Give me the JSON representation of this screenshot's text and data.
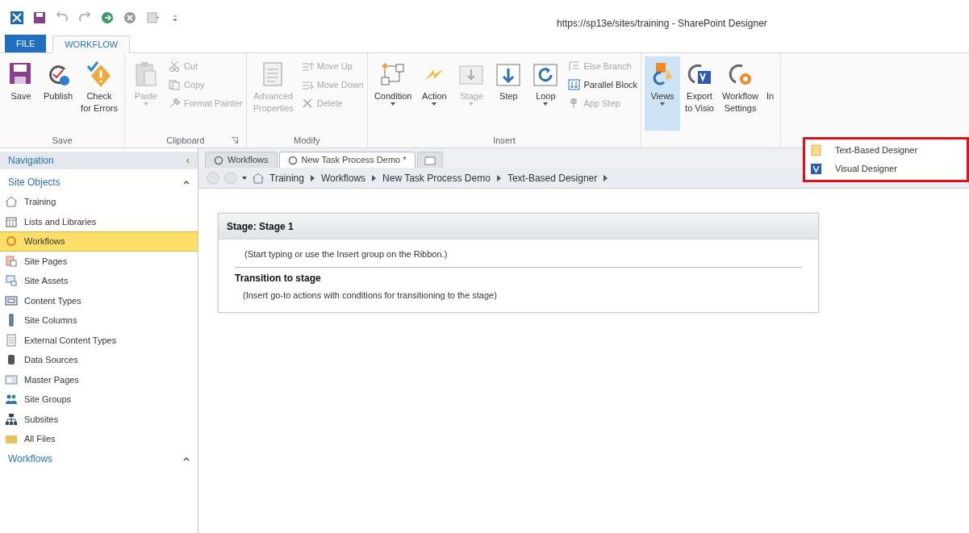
{
  "window": {
    "title": "https://sp13e/sites/training - SharePoint Designer"
  },
  "ribbon_tabs": [
    {
      "label": "FILE",
      "kind": "file",
      "selected": false
    },
    {
      "label": "WORKFLOW",
      "kind": "tab",
      "selected": true
    }
  ],
  "ribbon_groups": [
    {
      "label": "Save",
      "launcher": false,
      "buttons": [
        {
          "label": "Save",
          "kind": "large",
          "disabled": false,
          "dropdown": false,
          "selected": false
        },
        {
          "label": "Publish",
          "kind": "large",
          "disabled": false,
          "dropdown": false,
          "selected": false
        },
        {
          "label": "Check\nfor Errors",
          "kind": "large",
          "disabled": false,
          "dropdown": false,
          "selected": false
        }
      ]
    },
    {
      "label": "Clipboard",
      "launcher": true,
      "buttons": [
        {
          "label": "Paste",
          "kind": "large",
          "disabled": true,
          "dropdown": true,
          "selected": false
        },
        {
          "label": "Cut",
          "kind": "small",
          "disabled": true,
          "dropdown": false,
          "selected": false
        },
        {
          "label": "Copy",
          "kind": "small",
          "disabled": true,
          "dropdown": false,
          "selected": false
        },
        {
          "label": "Format Painter",
          "kind": "small",
          "disabled": true,
          "dropdown": false,
          "selected": false
        }
      ]
    },
    {
      "label": "Modify",
      "launcher": false,
      "buttons": [
        {
          "label": "Advanced\nProperties",
          "kind": "large",
          "disabled": true,
          "dropdown": false,
          "selected": false
        },
        {
          "label": "Move Up",
          "kind": "small",
          "disabled": true,
          "dropdown": false,
          "selected": false
        },
        {
          "label": "Move Down",
          "kind": "small",
          "disabled": true,
          "dropdown": false,
          "selected": false
        },
        {
          "label": "Delete",
          "kind": "small",
          "disabled": true,
          "dropdown": false,
          "selected": false
        }
      ]
    },
    {
      "label": "Insert",
      "launcher": false,
      "buttons": [
        {
          "label": "Condition",
          "kind": "large",
          "disabled": false,
          "dropdown": true,
          "selected": false
        },
        {
          "label": "Action",
          "kind": "large",
          "disabled": false,
          "dropdown": true,
          "selected": false
        },
        {
          "label": "Stage",
          "kind": "large",
          "disabled": true,
          "dropdown": true,
          "selected": false
        },
        {
          "label": "Step",
          "kind": "large",
          "disabled": false,
          "dropdown": false,
          "selected": false
        },
        {
          "label": "Loop",
          "kind": "large",
          "disabled": false,
          "dropdown": true,
          "selected": false
        },
        {
          "label": "Else Branch",
          "kind": "small",
          "disabled": true,
          "dropdown": false,
          "selected": false
        },
        {
          "label": "Parallel Block",
          "kind": "small",
          "disabled": false,
          "dropdown": false,
          "selected": false
        },
        {
          "label": "App Step",
          "kind": "small",
          "disabled": true,
          "dropdown": false,
          "selected": false
        }
      ]
    },
    {
      "launcher": false,
      "buttons": [
        {
          "label": "Views",
          "kind": "large",
          "disabled": false,
          "dropdown": true,
          "selected": true
        },
        {
          "label": "Export\nto Visio",
          "kind": "large",
          "disabled": false,
          "dropdown": false,
          "selected": false
        },
        {
          "label": "Workflow\nSettings",
          "kind": "large",
          "disabled": false,
          "dropdown": false,
          "selected": false
        },
        {
          "label": "In",
          "kind": "large",
          "disabled": false,
          "dropdown": false,
          "selected": false
        }
      ]
    }
  ],
  "views_menu": {
    "items": [
      {
        "label": "Text-Based Designer"
      },
      {
        "label": "Visual Designer"
      }
    ]
  },
  "navigation": {
    "title": "Navigation",
    "collapse_glyph": "‹",
    "sections": [
      {
        "title": "Site Objects",
        "expanded": true,
        "items": [
          {
            "label": "Training",
            "selected": false
          },
          {
            "label": "Lists and Libraries",
            "selected": false
          },
          {
            "label": "Workflows",
            "selected": true
          },
          {
            "label": "Site Pages",
            "selected": false
          },
          {
            "label": "Site Assets",
            "selected": false
          },
          {
            "label": "Content Types",
            "selected": false
          },
          {
            "label": "Site Columns",
            "selected": false
          },
          {
            "label": "External Content Types",
            "selected": false
          },
          {
            "label": "Data Sources",
            "selected": false
          },
          {
            "label": "Master Pages",
            "selected": false
          },
          {
            "label": "Site Groups",
            "selected": false
          },
          {
            "label": "Subsites",
            "selected": false
          },
          {
            "label": "All Files",
            "selected": false
          }
        ]
      },
      {
        "title": "Workflows",
        "expanded": true
      }
    ]
  },
  "document_tabs": [
    {
      "label": "Workflows",
      "selected": false
    },
    {
      "label": "New Task Process Demo *",
      "selected": true
    }
  ],
  "breadcrumb": [
    "Training",
    "Workflows",
    "New Task Process Demo",
    "Text-Based Designer"
  ],
  "stage": {
    "title": "Stage: Stage 1",
    "hint": "(Start typing or use the Insert group on the Ribbon.)",
    "transition_title": "Transition to stage",
    "transition_hint": "(Insert go-to actions with conditions for transitioning to the stage)"
  }
}
